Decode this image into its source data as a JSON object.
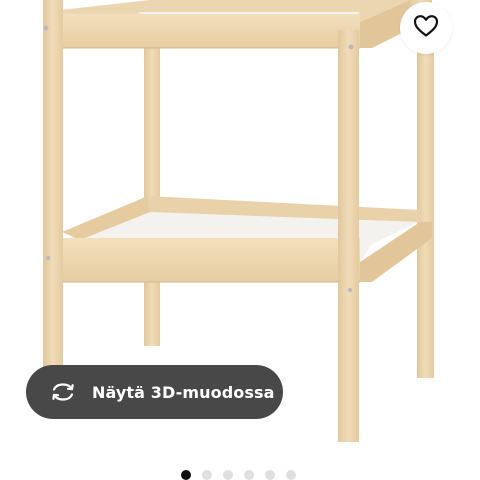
{
  "product": {
    "image_alt": "Changing table, beech/white"
  },
  "favourite": {
    "icon": "heart-icon"
  },
  "view_3d": {
    "icon": "rotate-3d-icon",
    "label": "Näytä 3D-muodossa"
  },
  "carousel": {
    "total": 6,
    "active_index": 0
  },
  "colors": {
    "wood": "#eed8b4",
    "wood_dark": "#d9bc8e",
    "shelf_white": "#f4f2ee",
    "pill_bg": "#484848",
    "dot_active": "#111111",
    "dot_inactive": "#dfdfdf"
  }
}
